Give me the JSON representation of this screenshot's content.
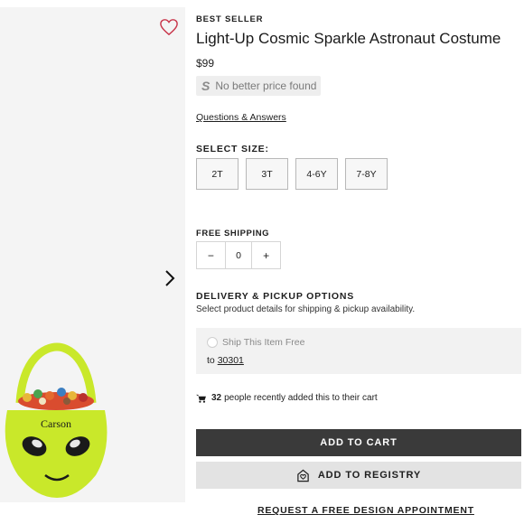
{
  "product": {
    "badge": "BEST SELLER",
    "title": "Light-Up Cosmic Sparkle Astronaut Costume",
    "price": "$99",
    "price_match_text": "No better price found",
    "price_match_icon": "S",
    "qa_link": "Questions & Answers",
    "image_caption": "Carson"
  },
  "sizes": {
    "label": "SELECT SIZE:",
    "options": [
      "2T",
      "3T",
      "4-6Y",
      "7-8Y"
    ]
  },
  "quantity": {
    "label": "FREE SHIPPING",
    "minus": "−",
    "value": "0",
    "plus": "+"
  },
  "delivery": {
    "label": "DELIVERY & PICKUP OPTIONS",
    "subtitle": "Select product details for shipping & pickup availability.",
    "ship_option": "Ship This Item Free",
    "to_prefix": "to",
    "zip": "30301"
  },
  "social_proof": {
    "count": "32",
    "text": "people recently added this to their cart"
  },
  "actions": {
    "add_to_cart": "ADD TO CART",
    "add_to_registry": "ADD TO REGISTRY",
    "design_appointment": "REQUEST A FREE DESIGN APPOINTMENT"
  },
  "icons": {
    "favorite": "heart-icon",
    "next": "chevron-right-icon",
    "cart": "cart-icon",
    "registry": "registry-icon"
  },
  "colors": {
    "favorite": "#c8354a",
    "primary_button": "#3a3a3a",
    "secondary_button": "#e3e3e3",
    "product_green": "#c9e82a"
  }
}
